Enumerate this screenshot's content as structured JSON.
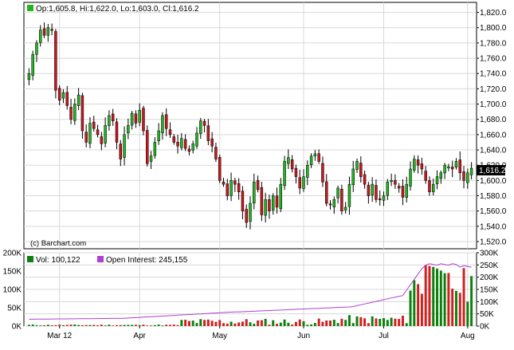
{
  "chart_data": {
    "type": "candlestick",
    "ohlc_header": "Op:1,605.8, Hi:1,622.0, Lo:1,603.0, Cl:1,616.2",
    "watermark": "(c) Barchart.com",
    "last_price_label": "1,616.2",
    "price_axis": {
      "ylim": [
        1520,
        1830
      ],
      "ticks": [
        1520,
        1540,
        1560,
        1580,
        1600,
        1620,
        1640,
        1660,
        1680,
        1700,
        1720,
        1740,
        1760,
        1780,
        1800,
        1820
      ],
      "tick_labels": [
        "1,520.0",
        "1,540.0",
        "1,560.0",
        "1,580.0",
        "1,600.0",
        "1,620.0",
        "1,640.0",
        "1,660.0",
        "1,680.0",
        "1,700.0",
        "1,720.0",
        "1,740.0",
        "1,760.0",
        "1,780.0",
        "1,800.0",
        "1,820.0"
      ]
    },
    "x_labels": [
      {
        "label": "Mar 12",
        "index": 8
      },
      {
        "label": "Apr",
        "index": 29
      },
      {
        "label": "May",
        "index": 50
      },
      {
        "label": "Jun",
        "index": 72
      },
      {
        "label": "Jul",
        "index": 93
      },
      {
        "label": "Aug",
        "index": 115
      }
    ],
    "close_series": [
      1740,
      1765,
      1780,
      1797,
      1790,
      1800,
      1797,
      1718,
      1705,
      1715,
      1698,
      1680,
      1700,
      1712,
      1665,
      1650,
      1675,
      1668,
      1660,
      1648,
      1672,
      1685,
      1678,
      1650,
      1628,
      1660,
      1672,
      1688,
      1675,
      1692,
      1665,
      1622,
      1632,
      1650,
      1665,
      1685,
      1668,
      1660,
      1650,
      1645,
      1655,
      1642,
      1638,
      1648,
      1662,
      1678,
      1672,
      1652,
      1645,
      1628,
      1600,
      1595,
      1580,
      1600,
      1595,
      1585,
      1560,
      1545,
      1570,
      1598,
      1588,
      1555,
      1575,
      1560,
      1580,
      1565,
      1595,
      1625,
      1630,
      1615,
      1605,
      1590,
      1605,
      1620,
      1632,
      1635,
      1625,
      1598,
      1570,
      1568,
      1575,
      1590,
      1560,
      1565,
      1595,
      1615,
      1625,
      1605,
      1595,
      1580,
      1595,
      1575,
      1575,
      1580,
      1598,
      1600,
      1595,
      1590,
      1578,
      1595,
      1615,
      1628,
      1620,
      1615,
      1600,
      1585,
      1595,
      1605,
      1610,
      1620,
      1618,
      1615,
      1625,
      1610,
      1600,
      1610,
      1616
    ],
    "volume_axis": {
      "ylim": [
        0,
        200000
      ],
      "tick_labels": [
        "0K",
        "50K",
        "100K",
        "150K",
        "200K"
      ],
      "ticks": [
        0,
        50000,
        100000,
        150000,
        200000
      ]
    },
    "oi_axis": {
      "ylim": [
        0,
        300000
      ],
      "tick_labels": [
        "0K",
        "50K",
        "100K",
        "150K",
        "200K",
        "250K",
        "300K"
      ],
      "ticks": [
        0,
        50000,
        100000,
        150000,
        200000,
        250000,
        300000
      ]
    },
    "volume_legend": "Vol: 100,122",
    "oi_legend": "Open Interest: 245,155",
    "colors": {
      "up": "#22b522",
      "down": "#c8191e",
      "volume_up": "#0c800c",
      "volume_down": "#d02020",
      "open_interest": "#b040d0",
      "grid": "#d8d8d8",
      "frame": "#000000"
    }
  }
}
